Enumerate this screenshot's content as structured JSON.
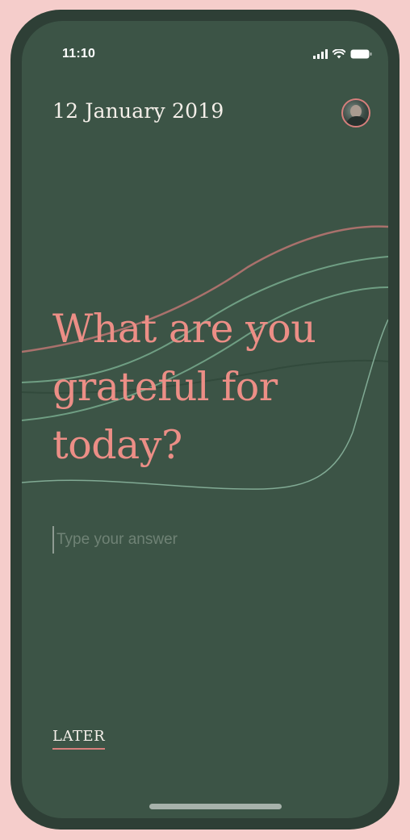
{
  "status_bar": {
    "time": "11:10",
    "icons": [
      "cellular-signal-icon",
      "wifi-icon",
      "battery-icon"
    ]
  },
  "header": {
    "date": "12 January 2019",
    "avatar_icon": "user-avatar"
  },
  "question": {
    "line1": "What are you",
    "line2": "grateful for",
    "line3": "today?"
  },
  "answer": {
    "value": "",
    "placeholder": "Type your answer"
  },
  "actions": {
    "later_label": "LATER"
  },
  "colors": {
    "background": "#f5cdcb",
    "device_frame": "#2e3f36",
    "screen": "#3c5446",
    "accent": "#ec8e86",
    "text_light": "#f4efe9",
    "wave_pink": "#a9716c",
    "wave_green": "#6f9e83"
  }
}
